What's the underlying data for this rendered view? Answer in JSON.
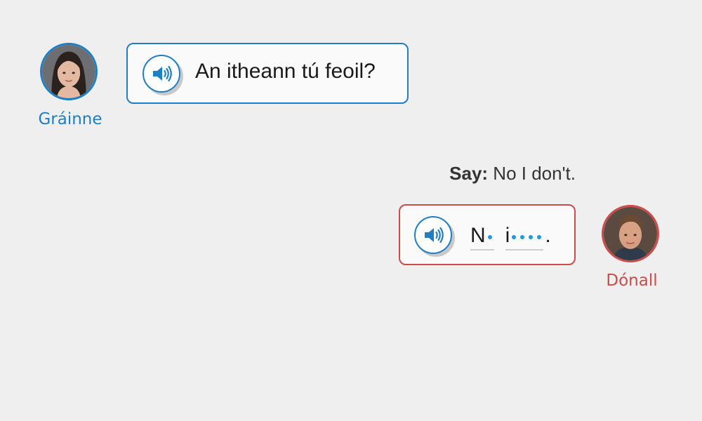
{
  "conversation": {
    "line1": {
      "speaker": "Gráinne",
      "text": "An itheann tú feoil?",
      "avatar_icon": "woman-avatar",
      "accent": "#1f7fc4"
    },
    "prompt": {
      "label": "Say:",
      "text": "No I don't."
    },
    "line2": {
      "speaker": "Dónall",
      "avatar_icon": "man-avatar",
      "accent": "#cf4a4a",
      "answer": {
        "word1_visible": "N",
        "word1_hidden_count": 1,
        "word2_visible": "i",
        "word2_hidden_count": 4,
        "punctuation": "."
      }
    }
  },
  "icons": {
    "audio": "speaker-icon"
  }
}
